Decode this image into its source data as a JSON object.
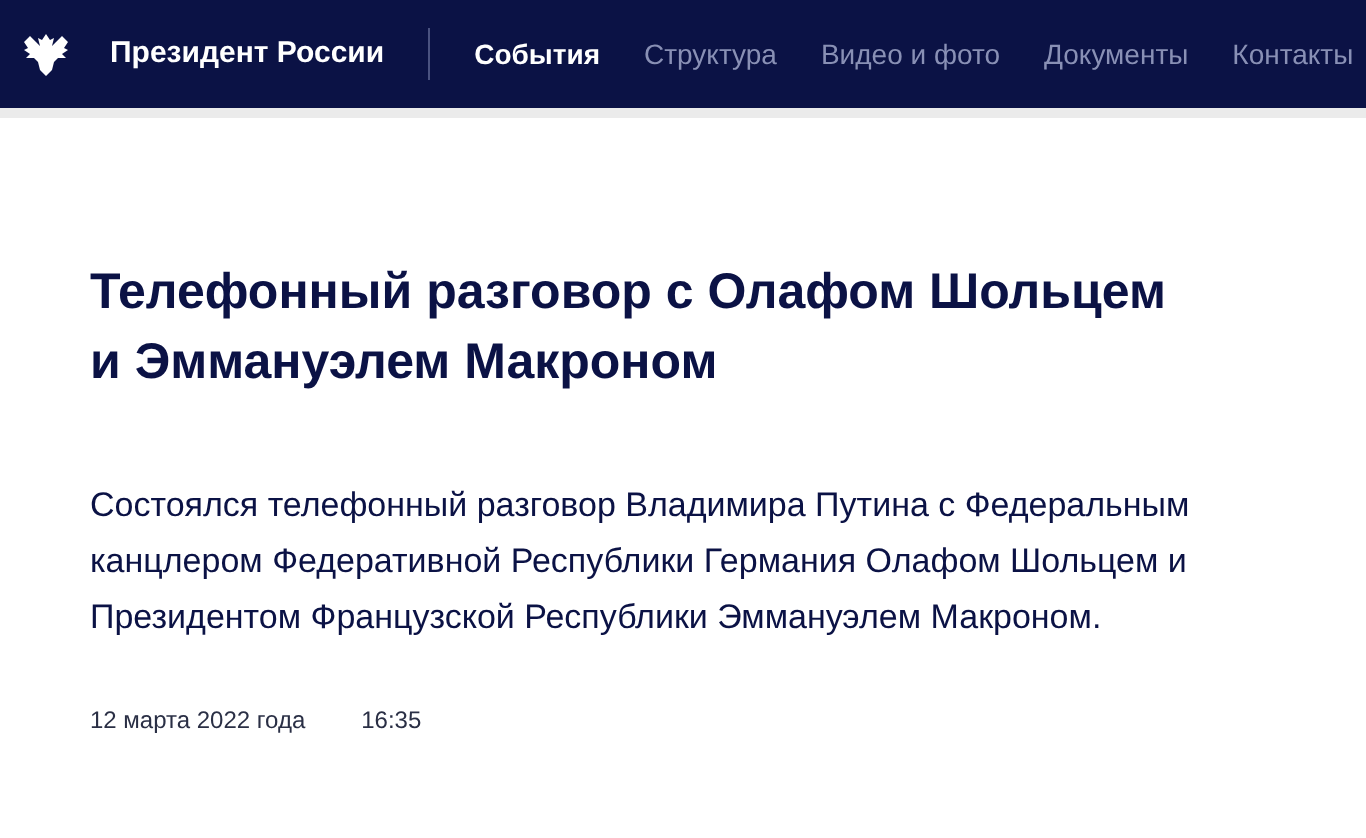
{
  "header": {
    "site_title": "Президент России",
    "nav": [
      {
        "label": "События",
        "selected": true
      },
      {
        "label": "Структура",
        "selected": false
      },
      {
        "label": "Видео и фото",
        "selected": false
      },
      {
        "label": "Документы",
        "selected": false
      },
      {
        "label": "Контакты",
        "selected": false
      }
    ]
  },
  "article": {
    "title": "Телефонный разговор с Олафом Шольцем и Эммануэлем Макроном",
    "lead": "Состоялся телефонный разговор Владимира Путина с Федеральным канцлером Федеративной Республики Германия Олафом Шольцем и Президентом Французской Республики Эммануэлем Макроном.",
    "date": "12 марта 2022 года",
    "time": "16:35"
  }
}
